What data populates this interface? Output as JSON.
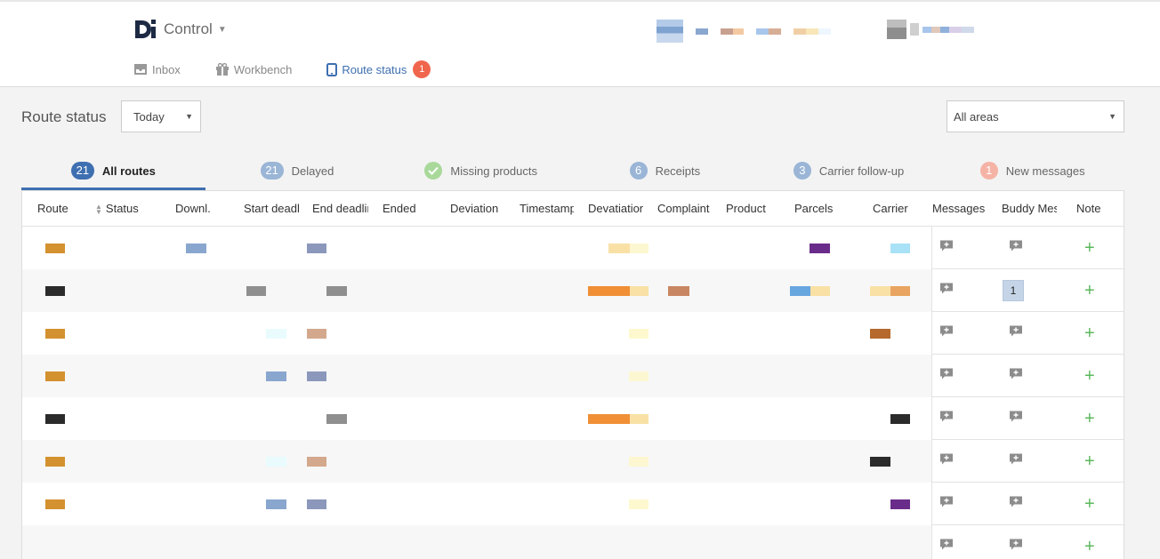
{
  "app": {
    "title": "Control"
  },
  "nav": [
    {
      "label": "Inbox",
      "icon": "inbox-icon"
    },
    {
      "label": "Workbench",
      "icon": "gift-icon"
    },
    {
      "label": "Route status",
      "icon": "tablet-icon",
      "active": true,
      "badge": "1"
    }
  ],
  "page": {
    "title": "Route status"
  },
  "filters": {
    "date": "Today",
    "area": "All areas"
  },
  "tabs": [
    {
      "count": "21",
      "label": "All routes",
      "style": "dark",
      "active": true
    },
    {
      "count": "21",
      "label": "Delayed",
      "style": "mid"
    },
    {
      "count": "",
      "label": "Missing products",
      "style": "green"
    },
    {
      "count": "6",
      "label": "Receipts",
      "style": "mid"
    },
    {
      "count": "3",
      "label": "Carrier follow-up",
      "style": "mid"
    },
    {
      "count": "1",
      "label": "New messages",
      "style": "pink"
    }
  ],
  "columns": [
    "Route",
    "Status",
    "Downl.",
    "Start deadline",
    "End deadline",
    "Ended",
    "Deviation",
    "Timestamp",
    "Devatiation",
    "Complaint",
    "Product",
    "Parcels",
    "Carrier",
    "Messages",
    "Buddy Messages",
    "Note"
  ],
  "rows": [
    {
      "buddy_count": ""
    },
    {
      "buddy_count": "1"
    },
    {
      "buddy_count": ""
    },
    {
      "buddy_count": ""
    },
    {
      "buddy_count": ""
    },
    {
      "buddy_count": ""
    },
    {
      "buddy_count": ""
    },
    {
      "buddy_count": ""
    }
  ],
  "colors": {
    "accent": "#3e6fb0",
    "badge": "#f0664d",
    "add": "#5cb85c"
  }
}
